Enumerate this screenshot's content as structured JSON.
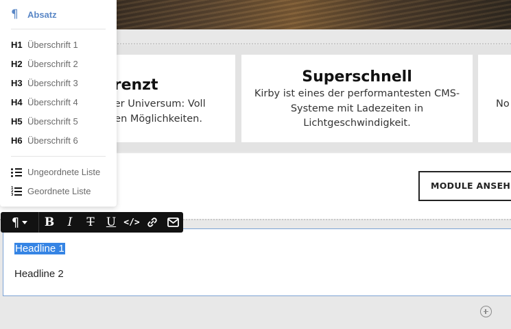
{
  "dropdown": {
    "active": {
      "label": "Absatz"
    },
    "headings": [
      {
        "key": "H1",
        "label": "Überschrift 1"
      },
      {
        "key": "H2",
        "label": "Überschrift 2"
      },
      {
        "key": "H3",
        "label": "Überschrift 3"
      },
      {
        "key": "H4",
        "label": "Überschrift 4"
      },
      {
        "key": "H5",
        "label": "Überschrift 5"
      },
      {
        "key": "H6",
        "label": "Überschrift 6"
      }
    ],
    "lists": [
      {
        "label": "Ungeordnete Liste",
        "icon": "unordered-list-icon"
      },
      {
        "label": "Geordnete Liste",
        "icon": "ordered-list-icon"
      }
    ]
  },
  "cards": [
    {
      "title": "grenzt",
      "line1": "nser Universum: Voll",
      "line2": "chen Möglichkeiten."
    },
    {
      "title": "Superschnell",
      "text": "Kirby ist eines der performantesten CMS-Systeme mit Ladezeiten in Lichtgeschwindigkeit."
    },
    {
      "text": "No"
    }
  ],
  "module_button": {
    "label": "MODULE ANSEHE"
  },
  "toolbar": {
    "bold": "B",
    "italic": "I",
    "strike": "T",
    "underline": "U",
    "code": "</>"
  },
  "editor": {
    "line1": "Headline 1",
    "line2": "Headline 2"
  }
}
